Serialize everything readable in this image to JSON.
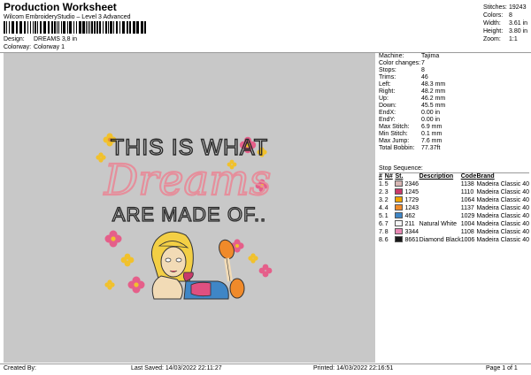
{
  "header": {
    "title": "Production Worksheet",
    "software": "Wilcom EmbroideryStudio – Level 3 Advanced",
    "design_label": "Design:",
    "design_value": "DREAMS 3,8 in",
    "colorway_label": "Colorway:",
    "colorway_value": "Colorway 1"
  },
  "stats": [
    {
      "label": "Stitches:",
      "value": "19243"
    },
    {
      "label": "Colors:",
      "value": "8"
    },
    {
      "label": "Width:",
      "value": "3.61 in"
    },
    {
      "label": "Height:",
      "value": "3.80 in"
    },
    {
      "label": "Zoom:",
      "value": "1:1"
    }
  ],
  "machine_info": [
    {
      "label": "Machine:",
      "value": "Tajima"
    },
    {
      "label": "Color changes:",
      "value": "7"
    },
    {
      "label": "Stops:",
      "value": "8"
    },
    {
      "label": "Trims:",
      "value": "46"
    },
    {
      "label": "Left:",
      "value": "48.3 mm"
    },
    {
      "label": "Right:",
      "value": "48.2 mm"
    },
    {
      "label": "Up:",
      "value": "46.2 mm"
    },
    {
      "label": "Down:",
      "value": "45.5 mm"
    },
    {
      "label": "EndX:",
      "value": "0.00 in"
    },
    {
      "label": "EndY:",
      "value": "0.00 in"
    },
    {
      "label": "Max Stitch:",
      "value": "6.9 mm"
    },
    {
      "label": "Min Stitch:",
      "value": "0.1 mm"
    },
    {
      "label": "Max Jump:",
      "value": "7.6 mm"
    },
    {
      "label": "Total Bobbin:",
      "value": "77.37ft"
    }
  ],
  "stop_sequence": {
    "title": "Stop Sequence:",
    "columns": [
      "#",
      "N#",
      "St.",
      "Description",
      "Code",
      "Brand"
    ],
    "rows": [
      {
        "num": "1.",
        "n": "5",
        "color": "#d7b7b4",
        "st": "2346",
        "desc": "",
        "code": "1138",
        "brand": "Madeira Classic 40"
      },
      {
        "num": "2.",
        "n": "3",
        "color": "#c83a6a",
        "st": "1245",
        "desc": "",
        "code": "1110",
        "brand": "Madeira Classic 40"
      },
      {
        "num": "3.",
        "n": "2",
        "color": "#f1a400",
        "st": "1729",
        "desc": "",
        "code": "1064",
        "brand": "Madeira Classic 40"
      },
      {
        "num": "4.",
        "n": "4",
        "color": "#f08a2a",
        "st": "1243",
        "desc": "",
        "code": "1137",
        "brand": "Madeira Classic 40"
      },
      {
        "num": "5.",
        "n": "1",
        "color": "#3f86c6",
        "st": "462",
        "desc": "",
        "code": "1029",
        "brand": "Madeira Classic 40"
      },
      {
        "num": "6.",
        "n": "7",
        "color": "#f4f4f4",
        "st": "211",
        "desc": "Natural White",
        "code": "1004",
        "brand": "Madeira Classic 40"
      },
      {
        "num": "7.",
        "n": "8",
        "color": "#e889b4",
        "st": "3344",
        "desc": "",
        "code": "1108",
        "brand": "Madeira Classic 40"
      },
      {
        "num": "8.",
        "n": "6",
        "color": "#1a1a1a",
        "st": "8661",
        "desc": "Diamond Black",
        "code": "1006",
        "brand": "Madeira Classic 40"
      }
    ]
  },
  "design_preview": {
    "line1": "THIS IS WHAT",
    "line2": "Dreams",
    "line3": "ARE MADE OF..",
    "background": "#c8c8c8",
    "text_color": "#2a2a2a",
    "script_color": "#e58f9c"
  },
  "footer": {
    "created": "Created By:",
    "saved": "Last Saved: 14/03/2022 22:11:27",
    "printed": "Printed: 14/03/2022 22:16:51",
    "page": "Page 1 of 1"
  }
}
